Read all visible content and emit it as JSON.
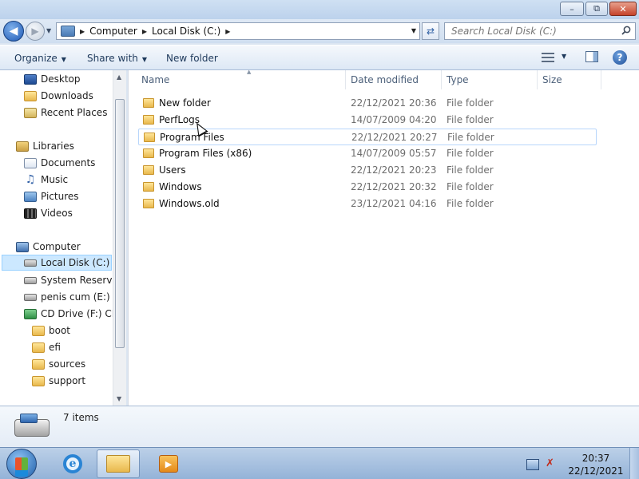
{
  "window": {
    "minimize": "–",
    "maximize": "⧉",
    "close": "✕"
  },
  "address": {
    "crumbs": [
      "Computer",
      "Local Disk (C:)"
    ],
    "search_placeholder": "Search Local Disk (C:)"
  },
  "commands": {
    "organize": "Organize",
    "share_with": "Share with",
    "new_folder": "New folder"
  },
  "nav": {
    "items": [
      {
        "label": "Desktop",
        "icon": "desktop"
      },
      {
        "label": "Downloads",
        "icon": "downloads"
      },
      {
        "label": "Recent Places",
        "icon": "recent"
      },
      {
        "label": "Libraries",
        "icon": "libraries"
      },
      {
        "label": "Documents",
        "icon": "documents"
      },
      {
        "label": "Music",
        "icon": "music"
      },
      {
        "label": "Pictures",
        "icon": "pictures"
      },
      {
        "label": "Videos",
        "icon": "videos"
      },
      {
        "label": "Computer",
        "icon": "computer"
      },
      {
        "label": "Local Disk (C:)",
        "icon": "disk"
      },
      {
        "label": "System Reserved",
        "icon": "disk"
      },
      {
        "label": "penis cum (E:)",
        "icon": "disk"
      },
      {
        "label": "CD Drive (F:) CES",
        "icon": "cd"
      },
      {
        "label": "boot",
        "icon": "folder"
      },
      {
        "label": "efi",
        "icon": "folder"
      },
      {
        "label": "sources",
        "icon": "folder"
      },
      {
        "label": "support",
        "icon": "folder"
      }
    ]
  },
  "columns": {
    "name": "Name",
    "date": "Date modified",
    "type": "Type",
    "size": "Size"
  },
  "files": [
    {
      "name": "New folder",
      "date": "22/12/2021 20:36",
      "type": "File folder"
    },
    {
      "name": "PerfLogs",
      "date": "14/07/2009 04:20",
      "type": "File folder"
    },
    {
      "name": "Program Files",
      "date": "22/12/2021 20:27",
      "type": "File folder"
    },
    {
      "name": "Program Files (x86)",
      "date": "14/07/2009 05:57",
      "type": "File folder"
    },
    {
      "name": "Users",
      "date": "22/12/2021 20:23",
      "type": "File folder"
    },
    {
      "name": "Windows",
      "date": "22/12/2021 20:32",
      "type": "File folder"
    },
    {
      "name": "Windows.old",
      "date": "23/12/2021 04:16",
      "type": "File folder"
    }
  ],
  "status": {
    "count": "7 items"
  },
  "taskbar": {
    "ie_glyph": "e",
    "time": "20:37",
    "date": "22/12/2021"
  }
}
